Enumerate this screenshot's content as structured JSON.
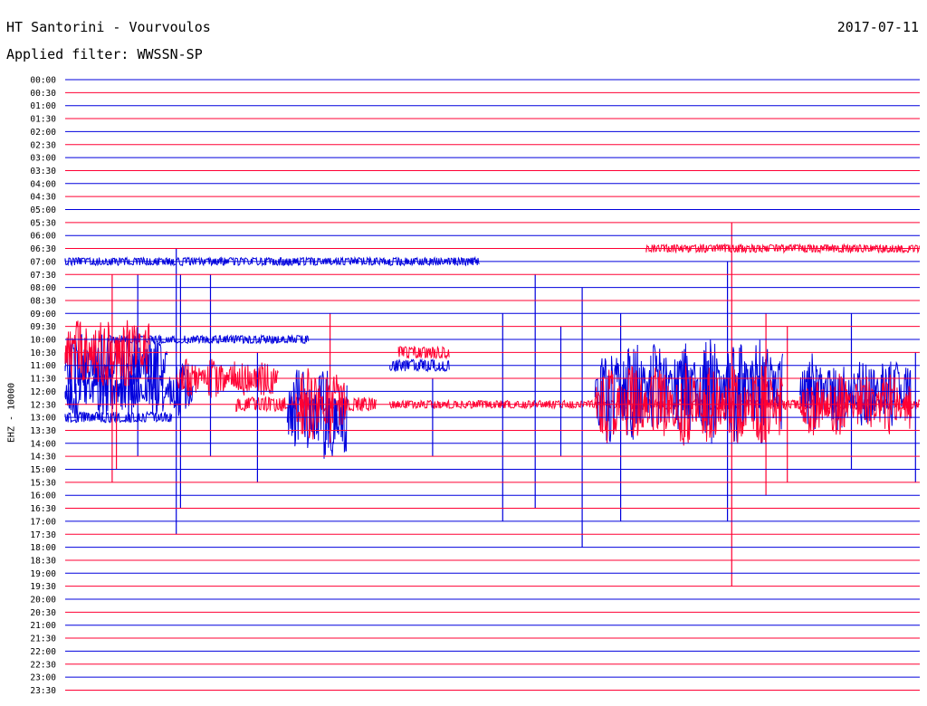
{
  "header": {
    "station": "HT Santorini - Vourvoulos",
    "date": "2017-07-11",
    "filter": "Applied filter: WWSSN-SP"
  },
  "colors": {
    "odd_rows": "#0000dd",
    "even_rows": "#ff0033"
  },
  "chart_data": {
    "type": "line",
    "title": "HT Santorini - Vourvoulos",
    "ylabel": "EHZ - 10000",
    "row_labels": [
      "00:00",
      "00:30",
      "01:00",
      "01:30",
      "02:00",
      "02:30",
      "03:00",
      "03:30",
      "04:00",
      "04:30",
      "05:00",
      "05:30",
      "06:00",
      "06:30",
      "07:00",
      "07:30",
      "08:00",
      "08:30",
      "09:00",
      "09:30",
      "10:00",
      "10:30",
      "11:00",
      "11:30",
      "12:00",
      "12:30",
      "13:00",
      "13:30",
      "14:00",
      "14:30",
      "15:00",
      "15:30",
      "16:00",
      "16:30",
      "17:00",
      "17:30",
      "18:00",
      "18:30",
      "19:00",
      "19:30",
      "20:00",
      "20:30",
      "21:00",
      "21:30",
      "22:00",
      "22:30",
      "23:00",
      "23:30"
    ],
    "row_minutes": 30,
    "grid": false,
    "series_colors": [
      "#0000dd",
      "#ff0033"
    ],
    "noisy_segments": [
      {
        "row": 14,
        "start": 0.0,
        "end": 0.485,
        "amp": 0.3
      },
      {
        "row": 13,
        "start": 0.68,
        "end": 1.0,
        "amp": 0.3
      },
      {
        "row": 20,
        "start": 0.05,
        "end": 0.285,
        "amp": 0.3
      },
      {
        "row": 21,
        "start": 0.39,
        "end": 0.45,
        "amp": 0.45
      },
      {
        "row": 26,
        "start": 0.0,
        "end": 0.125,
        "amp": 0.4
      },
      {
        "row": 25,
        "start": 0.2,
        "end": 0.365,
        "amp": 0.55
      },
      {
        "row": 25,
        "start": 0.38,
        "end": 0.66,
        "amp": 0.3
      },
      {
        "row": 25,
        "start": 0.66,
        "end": 1.0,
        "amp": 0.4
      },
      {
        "row": 22,
        "start": 0.38,
        "end": 0.45,
        "amp": 0.45
      }
    ],
    "bursts": [
      {
        "row": 22,
        "start": 0.0,
        "end": 0.12,
        "amp": 2.6
      },
      {
        "row": 24,
        "start": 0.0,
        "end": 0.15,
        "amp": 2.2
      },
      {
        "row": 21,
        "start": 0.0,
        "end": 0.1,
        "amp": 2.8
      },
      {
        "row": 23,
        "start": 0.13,
        "end": 0.25,
        "amp": 1.6
      },
      {
        "row": 26,
        "start": 0.26,
        "end": 0.33,
        "amp": 4.0
      },
      {
        "row": 25,
        "start": 0.27,
        "end": 0.33,
        "amp": 3.0
      },
      {
        "row": 24,
        "start": 0.62,
        "end": 0.84,
        "amp": 4.2
      },
      {
        "row": 25,
        "start": 0.62,
        "end": 0.84,
        "amp": 3.2
      },
      {
        "row": 24,
        "start": 0.86,
        "end": 0.99,
        "amp": 3.0
      },
      {
        "row": 25,
        "start": 0.86,
        "end": 0.99,
        "amp": 2.4
      }
    ],
    "spikes": [
      {
        "row": 24,
        "pos": 0.13,
        "amp": 22
      },
      {
        "row": 24,
        "pos": 0.135,
        "amp": 18
      },
      {
        "row": 26,
        "pos": 0.512,
        "amp": 16
      },
      {
        "row": 24,
        "pos": 0.55,
        "amp": 18
      },
      {
        "row": 26,
        "pos": 0.605,
        "amp": 20
      },
      {
        "row": 26,
        "pos": 0.65,
        "amp": 16
      },
      {
        "row": 25,
        "pos": 0.78,
        "amp": 28
      },
      {
        "row": 24,
        "pos": 0.775,
        "amp": 20
      },
      {
        "row": 25,
        "pos": 0.82,
        "amp": 14
      },
      {
        "row": 26,
        "pos": 0.995,
        "amp": 10
      },
      {
        "row": 23,
        "pos": 0.055,
        "amp": 16
      },
      {
        "row": 22,
        "pos": 0.17,
        "amp": 14
      },
      {
        "row": 23,
        "pos": 0.31,
        "amp": 10
      },
      {
        "row": 26,
        "pos": 0.225,
        "amp": 10
      },
      {
        "row": 24,
        "pos": 0.92,
        "amp": 12
      },
      {
        "row": 25,
        "pos": 0.845,
        "amp": 12
      },
      {
        "row": 24,
        "pos": 0.58,
        "amp": 10
      },
      {
        "row": 26,
        "pos": 0.43,
        "amp": 6
      },
      {
        "row": 25,
        "pos": 0.06,
        "amp": 10
      },
      {
        "row": 22,
        "pos": 0.085,
        "amp": 14
      }
    ]
  }
}
